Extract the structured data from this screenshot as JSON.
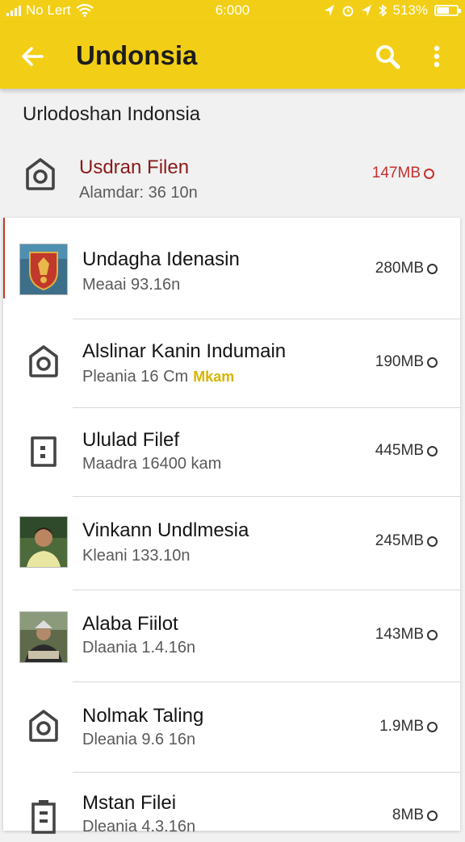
{
  "status_bar": {
    "carrier": "No Lert",
    "time": "6:000",
    "battery": "513%",
    "battery_fraction": 0.56
  },
  "app_bar": {
    "title": "Undonsia",
    "back_icon": "arrow-left-icon",
    "search_icon": "search-icon",
    "more_icon": "more-vert-icon"
  },
  "section": {
    "title": "Urlodoshan Indonsia"
  },
  "featured": {
    "title": "Usdran Filen",
    "subtitle": "Alamdar: 36 10n",
    "size": "147MB",
    "icon": "camera-icon",
    "accent_color": "#8a1a1a"
  },
  "items": [
    {
      "title": "Undagha Idenasin",
      "subtitle": "Meaai 93.16n",
      "tag": "",
      "size": "280MB",
      "icon": "emblem-thumbnail"
    },
    {
      "title": "Alslinar Kanin Indumain",
      "subtitle": "Pleania 16 Cm",
      "tag": "Mkam",
      "size": "190MB",
      "icon": "camera-icon"
    },
    {
      "title": "Ululad Filef",
      "subtitle": "Maadra 16400 kam",
      "tag": "",
      "size": "445MB",
      "icon": "document-icon"
    },
    {
      "title": "Vinkann Undlmesia",
      "subtitle": "Kleani 133.10n",
      "tag": "",
      "size": "245MB",
      "icon": "person-thumbnail"
    },
    {
      "title": "Alaba Fiilot",
      "subtitle": "Dlaania 1.4.16n",
      "tag": "",
      "size": "143MB",
      "icon": "person-thumbnail"
    },
    {
      "title": "Nolmak Taling",
      "subtitle": "Dleania 9.6 16n",
      "tag": "",
      "size": "1.9MB",
      "icon": "camera-icon"
    },
    {
      "title": "Mstan Filei",
      "subtitle": "Dleania 4.3.16n",
      "tag": "",
      "size": "8MB",
      "icon": "battery-file-icon"
    }
  ]
}
